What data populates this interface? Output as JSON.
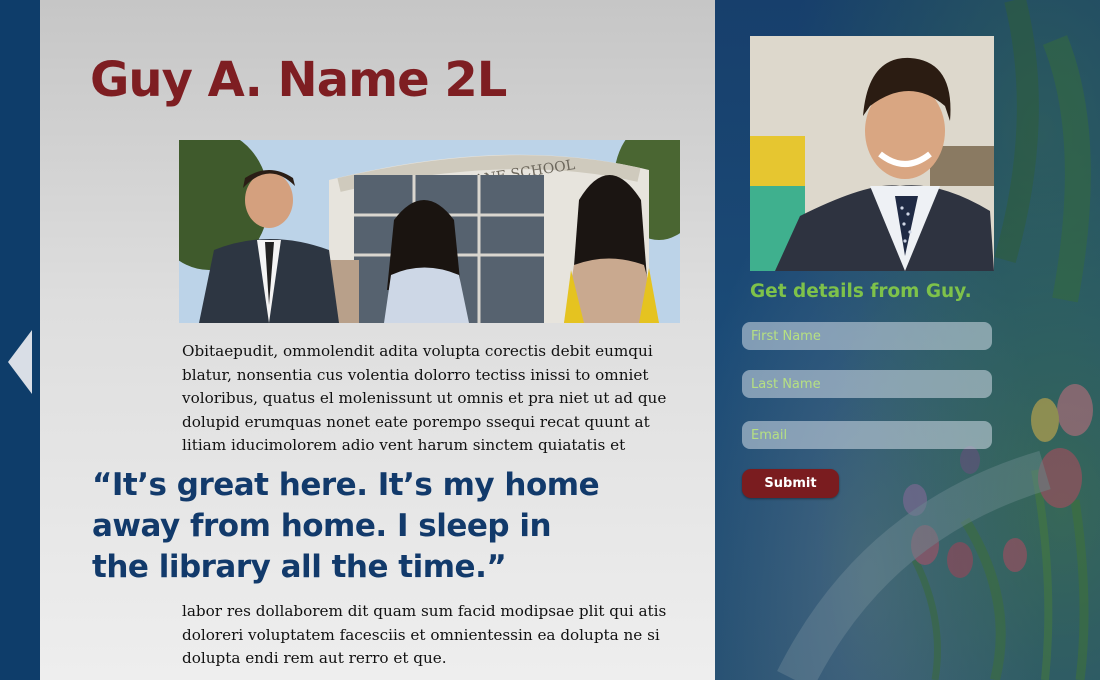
{
  "profile": {
    "name": "Guy A. Name 2L"
  },
  "content": {
    "paragraph_1": "Obitaepudit, ommolendit adita volupta corectis debit eumqui blatur, nonsentia cus volentia dolorro tectiss inissi to omniet voloribus, quatus el molenissunt ut omnis et pra niet ut ad que dolupid erumquas nonet eate porempo ssequi recat quunt at litiam iducimolorem adio vent harum sinctem quiatatis et",
    "quote": "“It’s great here. It’s my home\n away from home. I sleep in\n the library all the time.”",
    "paragraph_2": "labor res dollaborem dit quam sum facid modipsae plit qui atis doloreri voluptatem facesciis et omnientessin ea dolupta ne si dolupta endi rem aut rerro et que."
  },
  "hero_photo": {
    "building_sign": "URICE A. DEANE SCHOOL"
  },
  "contact_form": {
    "heading": "Get details from Guy.",
    "first_name_placeholder": "First Name",
    "last_name_placeholder": "Last Name",
    "email_placeholder": "Email",
    "submit_label": "Submit"
  },
  "navigation": {
    "back_icon": "triangle-left-icon"
  },
  "colors": {
    "title": "#7e1e22",
    "quote": "#123a6b",
    "accent_green": "#7ec24a",
    "submit": "#7a1c1f",
    "navy": "#0e3d6a"
  }
}
